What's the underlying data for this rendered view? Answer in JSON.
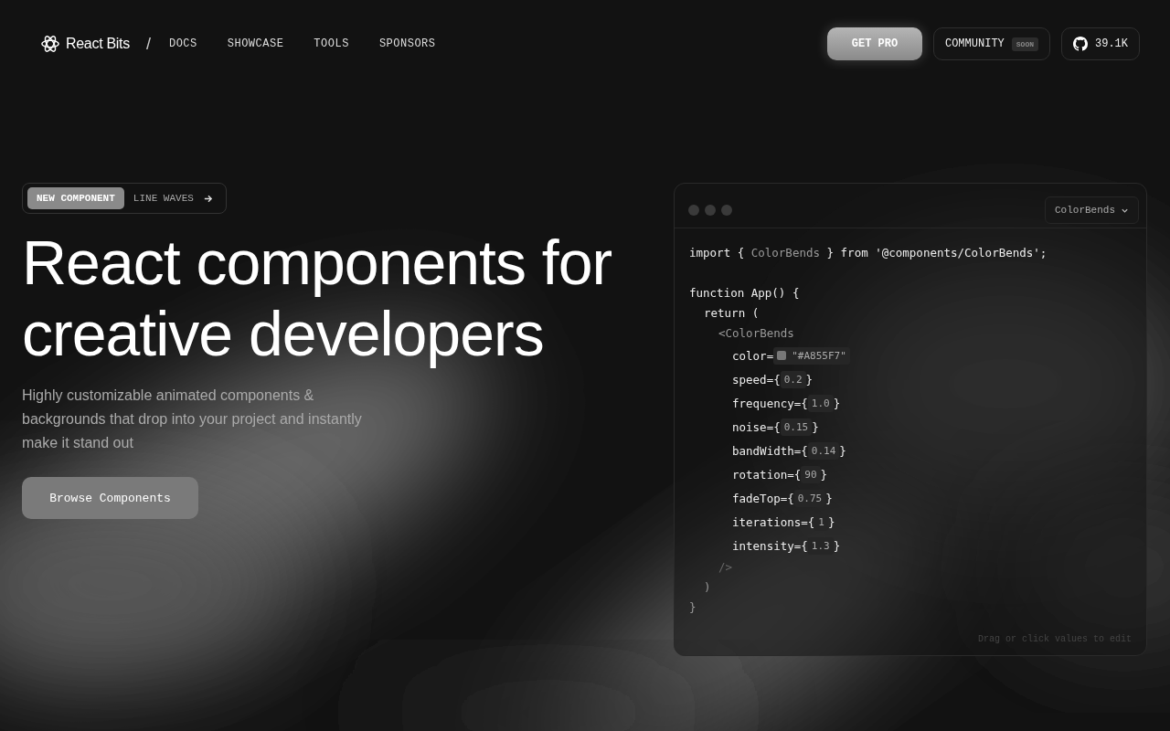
{
  "nav": {
    "brand": "React Bits",
    "separator": "/",
    "links": [
      "DOCS",
      "SHOWCASE",
      "TOOLS",
      "SPONSORS"
    ],
    "pro_button": "GET PRO",
    "community": {
      "label": "COMMUNITY",
      "badge": "SOON"
    },
    "github": {
      "stars": "39.1K"
    }
  },
  "hero": {
    "announcement": {
      "badge": "NEW COMPONENT",
      "label": "LINE WAVES"
    },
    "title": [
      "React components for",
      "creative developers"
    ],
    "subtitle": "Highly customizable animated components & backgrounds that drop into your project and instantly make it stand out",
    "cta": "Browse Components"
  },
  "code": {
    "selector": "ColorBends",
    "import": {
      "keyword": "import {",
      "name": "ColorBends",
      "rest": "} from '@components/ColorBends';"
    },
    "function_line": "function App() {",
    "return_line": "return (",
    "tag_open": "<ColorBends",
    "props": [
      {
        "kind": "color",
        "name": "color=",
        "value": "\"#A855F7\""
      },
      {
        "kind": "number",
        "name": "speed={",
        "value": "0.2",
        "close": "}"
      },
      {
        "kind": "number",
        "name": "frequency={",
        "value": "1.0",
        "close": "}"
      },
      {
        "kind": "number",
        "name": "noise={",
        "value": "0.15",
        "close": "}"
      },
      {
        "kind": "number",
        "name": "bandWidth={",
        "value": "0.14",
        "close": "}"
      },
      {
        "kind": "number",
        "name": "rotation={",
        "value": "90",
        "close": "}"
      },
      {
        "kind": "number",
        "name": "fadeTop={",
        "value": "0.75",
        "close": "}"
      },
      {
        "kind": "number",
        "name": "iterations={",
        "value": "1",
        "close": "}"
      },
      {
        "kind": "number",
        "name": "intensity={",
        "value": "1.3",
        "close": "}"
      }
    ],
    "tag_close": "/>",
    "paren_close": ")",
    "brace_close": "}",
    "hint": "Drag or click values to edit"
  }
}
